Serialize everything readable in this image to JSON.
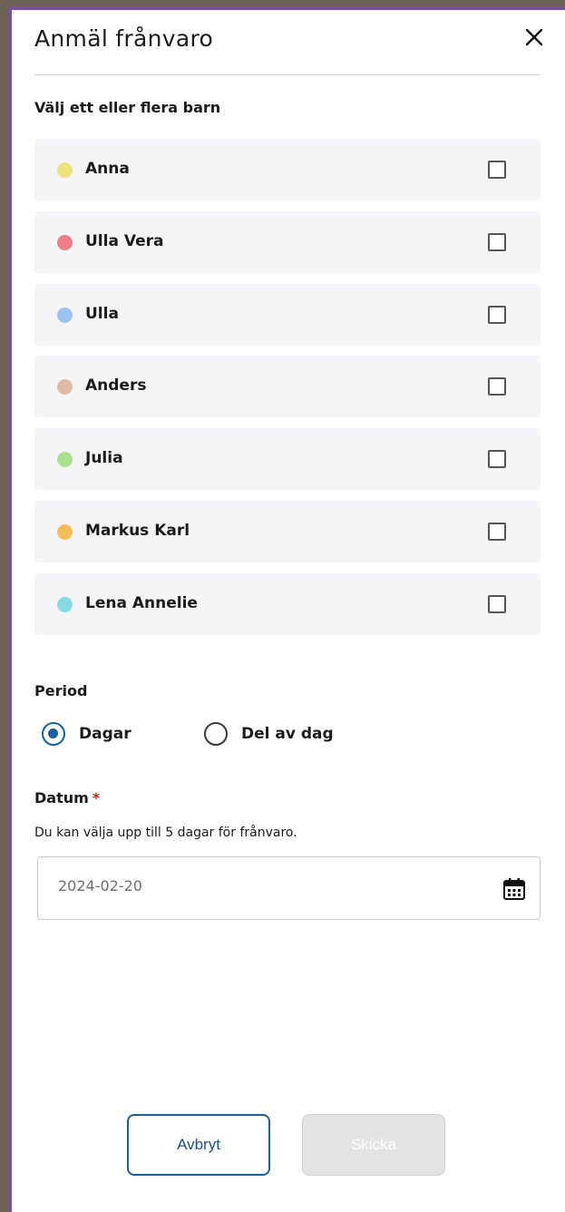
{
  "dialog": {
    "title": "Anmäl frånvaro",
    "close_icon": "close-icon"
  },
  "children_section": {
    "label": "Välj ett eller flera barn",
    "children": [
      {
        "name": "Anna",
        "color": "#ebe27a",
        "checked": false
      },
      {
        "name": "Ulla Vera",
        "color": "#f07c8a",
        "checked": false
      },
      {
        "name": "Ulla",
        "color": "#9cc2f2",
        "checked": false
      },
      {
        "name": "Anders",
        "color": "#ddbba4",
        "checked": false
      },
      {
        "name": "Julia",
        "color": "#a9e08f",
        "checked": false
      },
      {
        "name": "Markus Karl",
        "color": "#f6bd57",
        "checked": false
      },
      {
        "name": "Lena Annelie",
        "color": "#86dbe2",
        "checked": false
      }
    ]
  },
  "period": {
    "label": "Period",
    "options": [
      {
        "label": "Dagar",
        "selected": true
      },
      {
        "label": "Del av dag",
        "selected": false
      }
    ]
  },
  "date": {
    "label": "Datum",
    "required_mark": "*",
    "hint": "Du kan välja upp till 5 dagar för frånvaro.",
    "value": "2024-02-20",
    "calendar_icon": "calendar-icon"
  },
  "actions": {
    "cancel_label": "Avbryt",
    "submit_label": "Skicka",
    "submit_disabled": true
  },
  "colors": {
    "accent": "#1463a5",
    "panel_border": "#7b4fa8",
    "required": "#c0242b"
  }
}
